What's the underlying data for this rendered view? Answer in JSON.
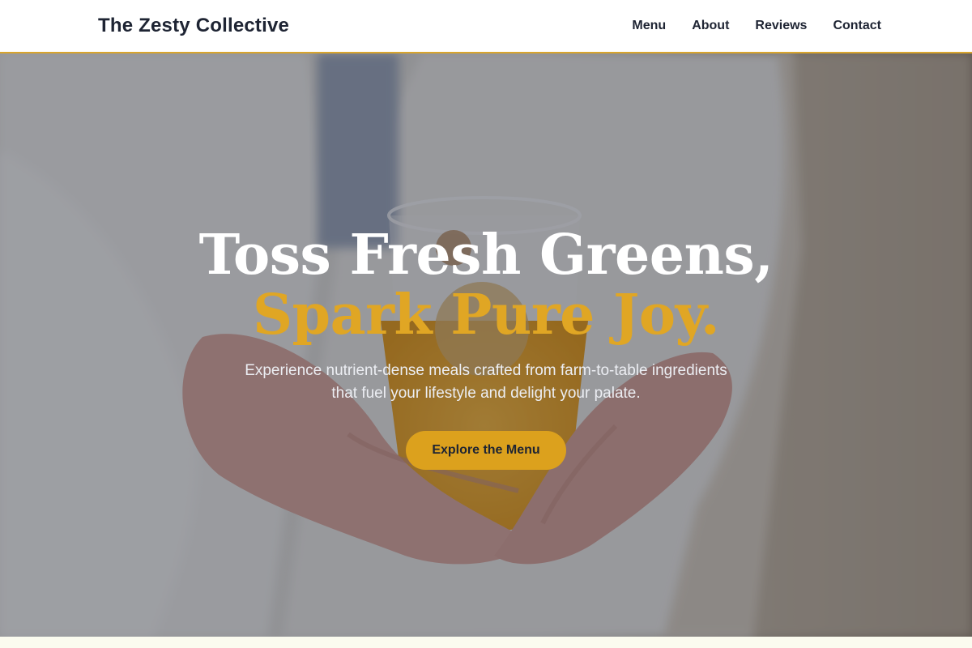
{
  "header": {
    "brand": "The Zesty Collective",
    "nav": [
      "Menu",
      "About",
      "Reviews",
      "Contact"
    ]
  },
  "hero": {
    "headline_line1": "Toss Fresh Greens,",
    "headline_line2": "Spark Pure Joy.",
    "subtext": "Experience nutrient-dense meals crafted from farm-to-table ingredients that fuel your lifestyle and delight your palate.",
    "cta_label": "Explore the Menu",
    "background_image": "person-holding-glass-of-orange-juice"
  },
  "colors": {
    "accent": "#dca11d",
    "text_dark": "#1e2433",
    "header_border": "#d9a52c"
  }
}
